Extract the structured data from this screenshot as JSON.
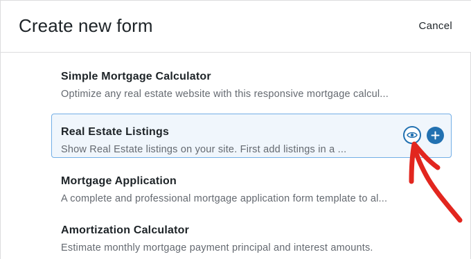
{
  "dialog": {
    "title": "Create new form",
    "cancel_label": "Cancel"
  },
  "templates": [
    {
      "title": "Simple Mortgage Calculator",
      "description": "Optimize any real estate website with this responsive mortgage calcul..."
    },
    {
      "title": "Real Estate Listings",
      "description": "Show Real Estate listings on your site. First add listings in a ..."
    },
    {
      "title": "Mortgage Application",
      "description": "A complete and professional mortgage application form template to al..."
    },
    {
      "title": "Amortization Calculator",
      "description": "Estimate monthly mortgage payment principal and interest amounts."
    }
  ],
  "actions": {
    "preview_icon": "eye-icon",
    "add_icon": "plus-icon"
  },
  "colors": {
    "accent": "#2271b1",
    "selected_bg": "#f0f6fc",
    "selected_border": "#72aee6",
    "annotation_arrow": "#e2261f"
  }
}
